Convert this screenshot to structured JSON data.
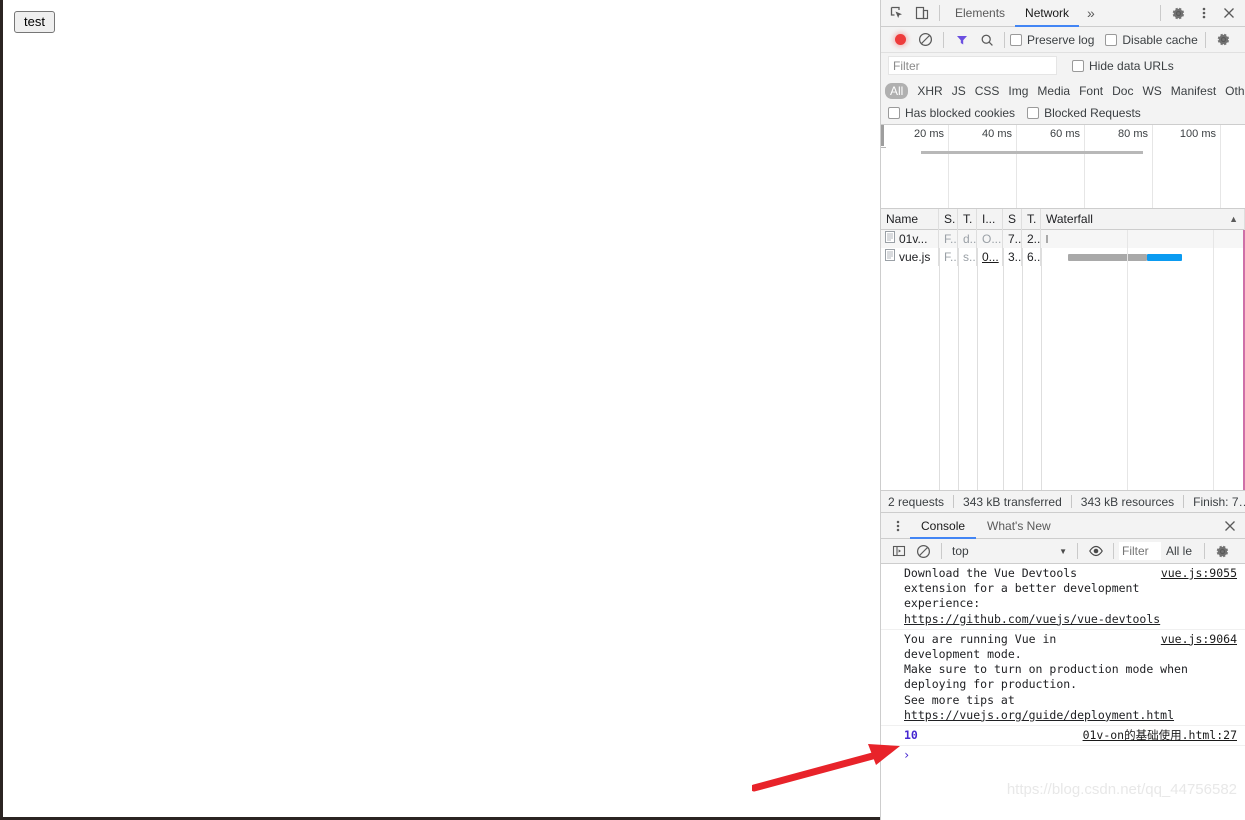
{
  "page": {
    "test_button_label": "test"
  },
  "devtools": {
    "tabbar": {
      "inspect_icon": "inspect-cursor-icon",
      "device_icon": "device-toggle-icon",
      "tabs": [
        {
          "label": "Elements",
          "active": false
        },
        {
          "label": "Network",
          "active": true
        }
      ],
      "more_tabs_label": "»",
      "settings_icon": "gear-icon",
      "kebab_icon": "more-vertical-icon",
      "close_icon": "close-icon"
    },
    "network": {
      "toolbar": {
        "record_icon": "record-dot-icon",
        "clear_icon": "clear-no-entry-icon",
        "filter_icon": "funnel-icon",
        "search_icon": "search-icon",
        "preserve_log_label": "Preserve log",
        "disable_cache_label": "Disable cachе",
        "network_settings_icon": "gear-icon"
      },
      "filter": {
        "placeholder": "Filter",
        "value": "",
        "hide_data_urls_label": "Hide data URLs"
      },
      "types": [
        "All",
        "XHR",
        "JS",
        "CSS",
        "Img",
        "Media",
        "Font",
        "Doc",
        "WS",
        "Manifest",
        "Oth"
      ],
      "types_active": "All",
      "blocked": {
        "has_blocked_cookies_label": "Has blocked cookies",
        "blocked_requests_label": "Blocked Requests"
      },
      "overview": {
        "ticks": [
          "20 ms",
          "40 ms",
          "60 ms",
          "80 ms",
          "100 ms"
        ]
      },
      "columns": [
        "Name",
        "S.",
        "T.",
        "I...",
        "S",
        "T.",
        "Waterfall"
      ],
      "sort_indicator": "▲",
      "rows": [
        {
          "icon": "document-icon",
          "name": "01v...",
          "status": "F..",
          "type": "d..",
          "initiator": "O...",
          "size": "7..",
          "time": "2..",
          "initiator_link": false
        },
        {
          "icon": "document-icon",
          "name": "vue.js",
          "status": "F..",
          "type": "s..",
          "initiator": "0...",
          "size": "3..",
          "time": "6..",
          "initiator_link": true
        }
      ],
      "status_bar": [
        "2 requests",
        "343 kB transferred",
        "343 kB resources",
        "Finish: 7…"
      ]
    },
    "drawer": {
      "kebab_icon": "more-vertical-icon",
      "tabs": [
        {
          "label": "Console",
          "active": true
        },
        {
          "label": "What's New",
          "active": false
        }
      ],
      "close_icon": "close-icon",
      "console_toolbar": {
        "sidebar_icon": "show-console-sidebar-icon",
        "clear_icon": "clear-no-entry-icon",
        "context": "top",
        "context_caret": "▼",
        "eye_icon": "live-expression-eye-icon",
        "filter_placeholder": "Filter",
        "filter_value": "",
        "levels_label": "All le",
        "settings_icon": "gear-icon"
      },
      "messages": [
        {
          "text": "Download the Vue Devtools extension for a better development experience:\nhttps://github.com/vuejs/vue-devtools",
          "link_start": "https://github.com/vuejs/vue-devtools",
          "source": "vue.js:9055",
          "kind": "info"
        },
        {
          "text": "You are running Vue in development mode.\nMake sure to turn on production mode when deploying for production.\nSee more tips at https://vuejs.org/guide/deployment.html",
          "link_start": "https://vuejs.org/guide/deployment.html",
          "source": "vue.js:9064",
          "kind": "info"
        },
        {
          "text": "10",
          "source": "01v-on的基础使用.html:27",
          "kind": "value"
        }
      ],
      "prompt_symbol": "›"
    }
  },
  "watermark": "https://blog.csdn.net/qq_44756582",
  "annotation": {
    "arrow_color": "#e8232a",
    "arrow_name": "red-pointer-arrow"
  },
  "colors": {
    "accent": "#4285f4",
    "record": "#ee3b3b",
    "waterfall_download": "#0b9bf1",
    "waterfall_wait": "#a9a9a9",
    "dcl_marker": "#d06fa8",
    "console_value": "#4527d1"
  }
}
